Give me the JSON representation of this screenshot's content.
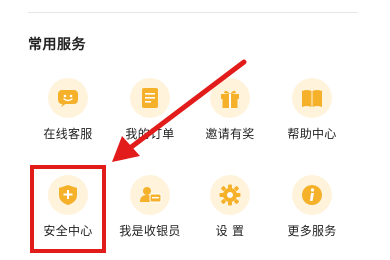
{
  "section": {
    "title": "常用服务"
  },
  "services": [
    {
      "label": "在线客服",
      "icon": "chat-icon"
    },
    {
      "label": "我的订单",
      "icon": "document-icon"
    },
    {
      "label": "邀请有奖",
      "icon": "gift-icon"
    },
    {
      "label": "帮助中心",
      "icon": "book-icon"
    },
    {
      "label": "安全中心",
      "icon": "shield-plus-icon"
    },
    {
      "label": "我是收银员",
      "icon": "cashier-card-icon"
    },
    {
      "label": "设 置",
      "icon": "gear-icon"
    },
    {
      "label": "更多服务",
      "icon": "info-icon"
    }
  ],
  "colors": {
    "icon_bg": "#fff3dc",
    "icon_fg": "#f5b12a",
    "annotation": "#e21b1b"
  }
}
